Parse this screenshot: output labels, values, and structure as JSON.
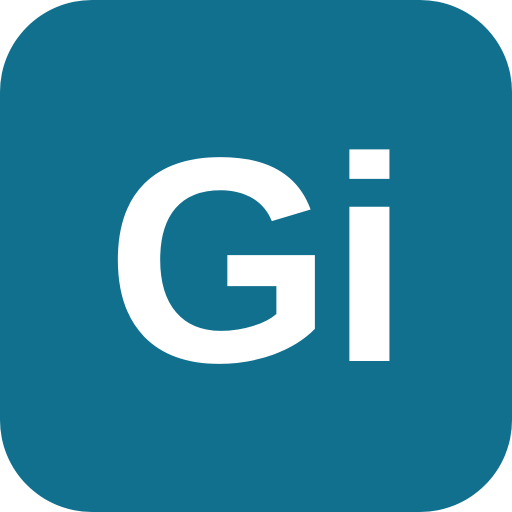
{
  "icon": {
    "label": "Gi",
    "background_color": "#10708e",
    "text_color": "#ffffff"
  }
}
